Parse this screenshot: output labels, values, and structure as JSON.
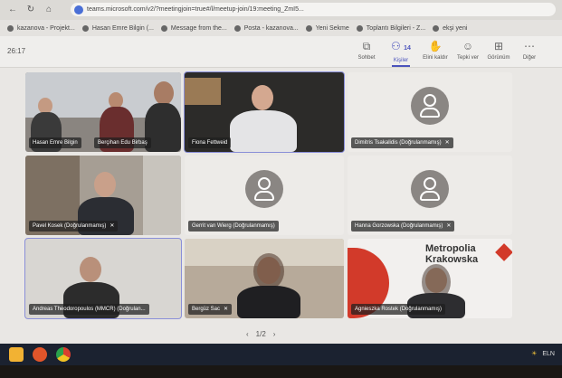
{
  "browser": {
    "url": "teams.microsoft.com/v2/?meetingjoin=true#/l/meetup-join/19:meeting_ZmI5...",
    "bookmarks": [
      {
        "label": "kazanova - Projekt..."
      },
      {
        "label": "Hasan Emre Bilgin (..."
      },
      {
        "label": "Message from the..."
      },
      {
        "label": "Posta - kazanova..."
      },
      {
        "label": "Yeni Sekme"
      },
      {
        "label": "Toplantı Bilgileri - Z..."
      },
      {
        "label": "ekşi yeni"
      }
    ]
  },
  "meeting": {
    "timer": "26:17",
    "toolbar": [
      {
        "icon": "share-icon",
        "label": "Sohbet"
      },
      {
        "icon": "people-icon",
        "label": "Kişiler",
        "count": "14",
        "active": true
      },
      {
        "icon": "raise-hand-icon",
        "label": "Elini kaldır"
      },
      {
        "icon": "react-icon",
        "label": "Tepki ver"
      },
      {
        "icon": "view-icon",
        "label": "Görünüm"
      },
      {
        "icon": "more-icon",
        "label": "Diğer"
      }
    ],
    "participants": [
      {
        "name": "Hasan Emre Bilgin",
        "name2": "Berçihan Edu Birbaş"
      },
      {
        "name": "Fiona Fettweid"
      },
      {
        "name": "Dimitris Tsakalidis (Doğrulanmamış)"
      },
      {
        "name": "Pavel Kosek (Doğrulanmamış)"
      },
      {
        "name": "Gerrit van Wierg (Doğrulanmamış)"
      },
      {
        "name": "Hanna Gorzowska (Doğrulanmamış)"
      },
      {
        "name": "Andreas Theodoropoulos (MMCR) (Doğrulan..."
      },
      {
        "name": "Bergüz Sac"
      },
      {
        "name": "Agnieszka Rostek (Doğrulanmamış)"
      }
    ],
    "brand": {
      "line1": "Metropolia",
      "line2": "Krakowska"
    },
    "pager": {
      "prev": "‹",
      "label": "1/2",
      "next": "›"
    }
  },
  "taskbar": {
    "right_text": "ELN"
  }
}
